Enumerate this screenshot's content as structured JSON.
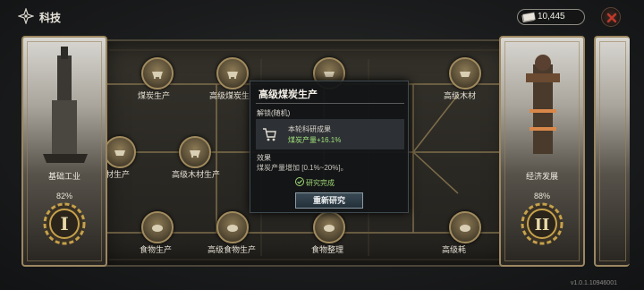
{
  "header": {
    "title": "科技",
    "currency_value": "10,445"
  },
  "board": {
    "nodes": [
      {
        "label": "煤炭生产"
      },
      {
        "label": "高级煤炭生"
      },
      {
        "label": ""
      },
      {
        "label": "高级木材"
      },
      {
        "label": "材生产"
      },
      {
        "label": "高级木材生产"
      },
      {
        "label": "食物生产"
      },
      {
        "label": "高级食物生产"
      },
      {
        "label": "食物整理"
      },
      {
        "label": "高级耗"
      }
    ]
  },
  "left_card": {
    "name": "基础工业",
    "progress_text": "82%",
    "progress": 0.82,
    "numeral": "I"
  },
  "right_card": {
    "name": "经济发展",
    "progress_text": "88%",
    "progress": 0.88,
    "numeral": "II"
  },
  "popup": {
    "title": "高级煤炭生产",
    "unlock_label": "解锁(随机)",
    "result_title": "本轮科研成果",
    "result_value": "煤炭产量+16.1%",
    "effect_label": "效果",
    "effect_text": "煤炭产量增加 [0.1%~20%]。",
    "complete_text": "研究完成",
    "redo_label": "重新研究"
  },
  "footer": {
    "version": "v1.0.1.10946001"
  },
  "colors": {
    "accent_gold": "#a18b5e",
    "positive_green": "#9fe07a",
    "close_red": "#c0392b"
  }
}
